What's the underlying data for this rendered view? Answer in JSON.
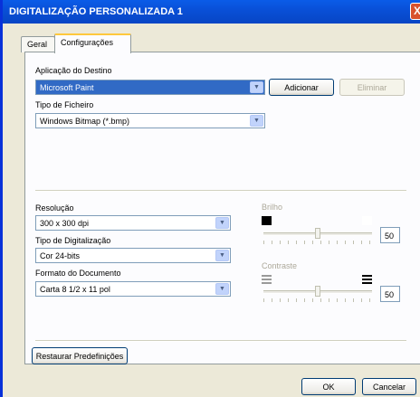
{
  "window": {
    "title": "DIGITALIZAÇÃO PERSONALIZADA 1",
    "close_glyph": "X"
  },
  "tabs": [
    {
      "label": "Geral"
    },
    {
      "label": "Configurações",
      "active": true
    }
  ],
  "destination": {
    "label": "Aplicação do Destino",
    "value": "Microsoft Paint",
    "add_label": "Adicionar",
    "remove_label": "Eliminar"
  },
  "file_type": {
    "label": "Tipo de Ficheiro",
    "value": "Windows Bitmap (*.bmp)"
  },
  "resolution": {
    "label": "Resolução",
    "value": "300 x 300 dpi"
  },
  "scan_type": {
    "label": "Tipo de Digitalização",
    "value": "Cor 24-bits"
  },
  "doc_format": {
    "label": "Formato do Documento",
    "value": "Carta 8 1/2 x 11 pol"
  },
  "brightness": {
    "label": "Brilho",
    "value": "50"
  },
  "contrast": {
    "label": "Contraste",
    "value": "50"
  },
  "restore_label": "Restaurar Predefinições",
  "ok_label": "OK",
  "cancel_label": "Cancelar"
}
